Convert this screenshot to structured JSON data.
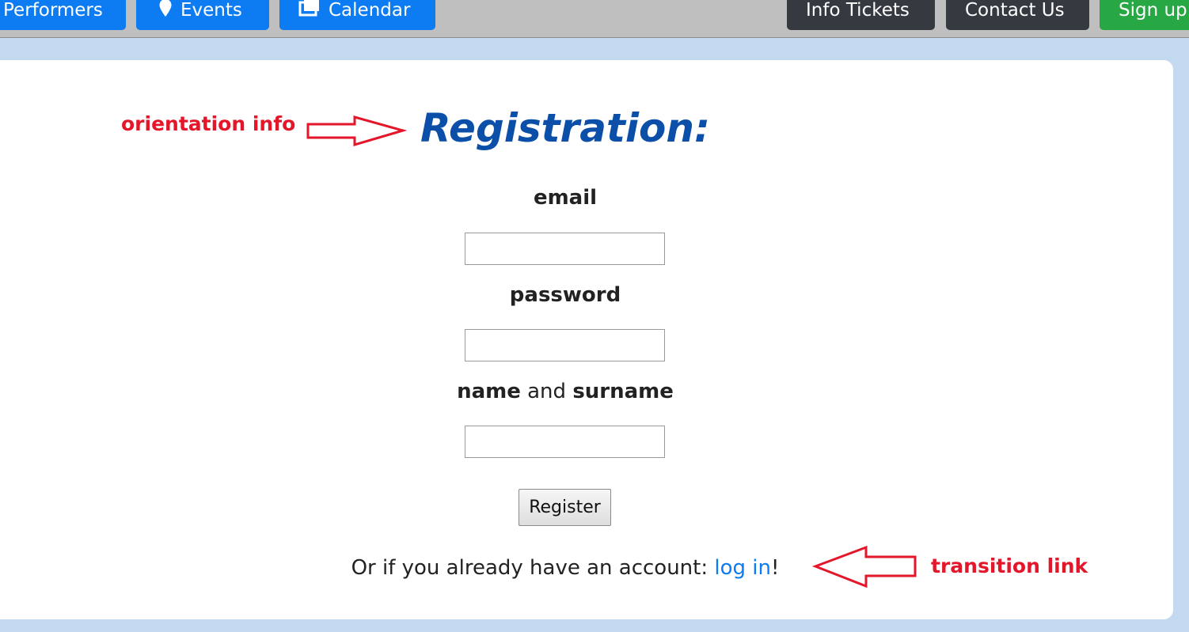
{
  "nav": {
    "performers": "Performers",
    "events": "Events",
    "calendar": "Calendar",
    "info_tickets": "Info Tickets",
    "contact_us": "Contact Us",
    "sign_up": "Sign up",
    "icons": {
      "events": "map-marker-icon",
      "calendar": "calendar-icon"
    },
    "colors": {
      "primary": "#0d7cf2",
      "dark": "#343a40",
      "success": "#28a745"
    }
  },
  "form": {
    "title": "Registration:",
    "email_label": "email",
    "email_value": "",
    "password_label": "password",
    "password_value": "",
    "name_label_part1": "name",
    "name_label_mid": " and ",
    "name_label_part2": "surname",
    "name_value": "",
    "register_label": "Register",
    "footer_prefix": "Or if you already have an account: ",
    "login_link": "log in",
    "footer_suffix": "!"
  },
  "annotations": {
    "orientation": "orientation info",
    "transition": "transition link",
    "color": "#e3162a"
  }
}
